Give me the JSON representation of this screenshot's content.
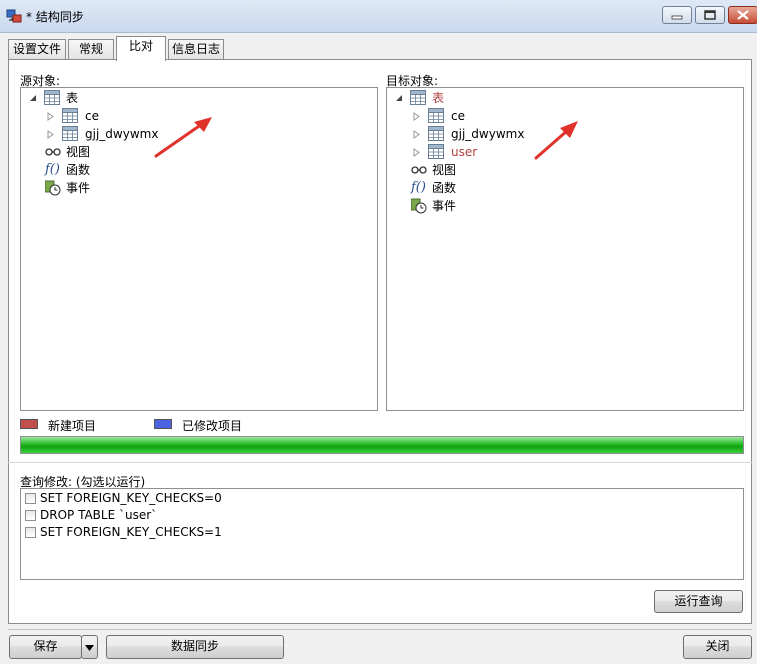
{
  "window": {
    "title": "* 结构同步",
    "controls": {
      "minimize": "▬",
      "maximize": "▢",
      "close": "✕"
    }
  },
  "tabs": [
    {
      "label": "设置文件",
      "active": false
    },
    {
      "label": "常规",
      "active": false
    },
    {
      "label": "比对",
      "active": true
    },
    {
      "label": "信息日志",
      "active": false
    }
  ],
  "source": {
    "label": "源对象:",
    "tree": {
      "table_group": "表",
      "tables": [
        "ce",
        "gjj_dwywmx"
      ],
      "view": "视图",
      "function": "函数",
      "event": "事件"
    }
  },
  "target": {
    "label": "目标对象:",
    "tree": {
      "table_group": "表",
      "tables": [
        "ce",
        "gjj_dwywmx",
        "user"
      ],
      "view": "视图",
      "function": "函数",
      "event": "事件"
    }
  },
  "legend": {
    "new_label": "新建项目",
    "modified_label": "已修改项目",
    "new_color": "#c0504d",
    "modified_color": "#4a63e0"
  },
  "progress": {
    "value": 1.0
  },
  "query": {
    "label": "查询修改: (勾选以运行)",
    "items": [
      "SET FOREIGN_KEY_CHECKS=0",
      "DROP TABLE `user`",
      "SET FOREIGN_KEY_CHECKS=1"
    ],
    "run_button": "运行查询"
  },
  "footer": {
    "save": "保存",
    "sync": "数据同步",
    "close": "关闭"
  },
  "colors": {
    "new_item_text": "#b04040",
    "arrow": "#e0322a"
  }
}
